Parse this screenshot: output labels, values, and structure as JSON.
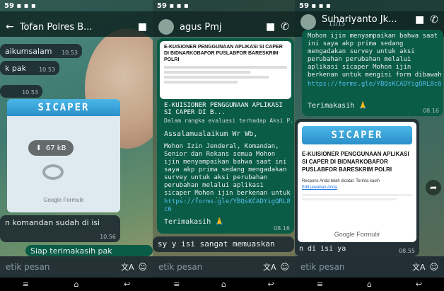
{
  "p1": {
    "status_time": "59",
    "contact": "Tofan Polres B...",
    "messages": [
      {
        "text": "aikumsalam",
        "time": "10.53"
      },
      {
        "text": "k pak",
        "time": "10.53"
      },
      {
        "text": "",
        "time": "10.53"
      }
    ],
    "media": {
      "banner": "SICAPER",
      "download": "67 kB",
      "footer": "Google Formulir"
    },
    "reply": {
      "text": "n komandan sudah di isi",
      "time": "10.56"
    },
    "out_msg": {
      "text": "Siap terimakasih pak",
      "time": ""
    },
    "input_placeholder": "etik pesan"
  },
  "p2": {
    "status_time": "59",
    "contact": "agus Pmj",
    "form_title": "E-KUISIONER PENGGUNAAN APLIKASI SI CAPER DI BIDNARKOBAFOR PUSLABFOR BARESKRIM POLRI",
    "preview_title": "E-KUISIONER PENGGUNAAN APLIKASI SI CAPER DI B...",
    "preview_sub": "Dalam rangka evaluasi terhadap Aksi P...",
    "greeting": "Assalamualaikum Wr Wb,",
    "body": "Mohon Izin Jenderal, Komandan, Senior dan Rekans semua Mohon ijin menyampaikan bahwa saat ini saya akp prima sedang mengadakan survey untuk aksi perubahan perubahan melalui aplikasi sicaper Mohon ijin berkenan untuk mengisi form dibawah ini.",
    "link": "https://forms.gle/YBQsKCADYigQRL8c6",
    "thanks": "Terimakasih 🙏",
    "time": "08.16",
    "reply": "sy y isi sangat memuaskan",
    "input_placeholder": "etik pesan"
  },
  "p3": {
    "status_time": "59",
    "contact": "Suhariyanto Jk...",
    "subline": "11/15",
    "top_text": "Mohon ijin menyampaikan bahwa saat ini saya akp prima sedang mengadakan survey untuk aksi perubahan perubahan melalui aplikasi sicaper Mohon ijin berkenan untuk mengisi form dibawah ini.",
    "link": "https://forms.gle/YBQsKCADYigQRL8c6",
    "thanks": "Terimakasih 🙏",
    "time_top": "08.16",
    "banner": "SICAPER",
    "doc_title": "E-KUISIONER PENGGUNAAN APLIKASI SI CAPER DI BIDNARKOBAFOR PUSLABFOR BARESKRIM POLRI",
    "doc_note": "Respons Anda telah dicatat. Terima kasih",
    "doc_link": "Edit jawaban Anda",
    "doc_footer": "Google Formulir",
    "reply": "n di isi ya",
    "reply_time": "08.55",
    "input_placeholder": "etik pesan"
  },
  "colors": {
    "out_bubble": "#0a5c46",
    "in_bubble": "#202c33",
    "link": "#53bdeb",
    "banner": "#2a8fc8"
  }
}
